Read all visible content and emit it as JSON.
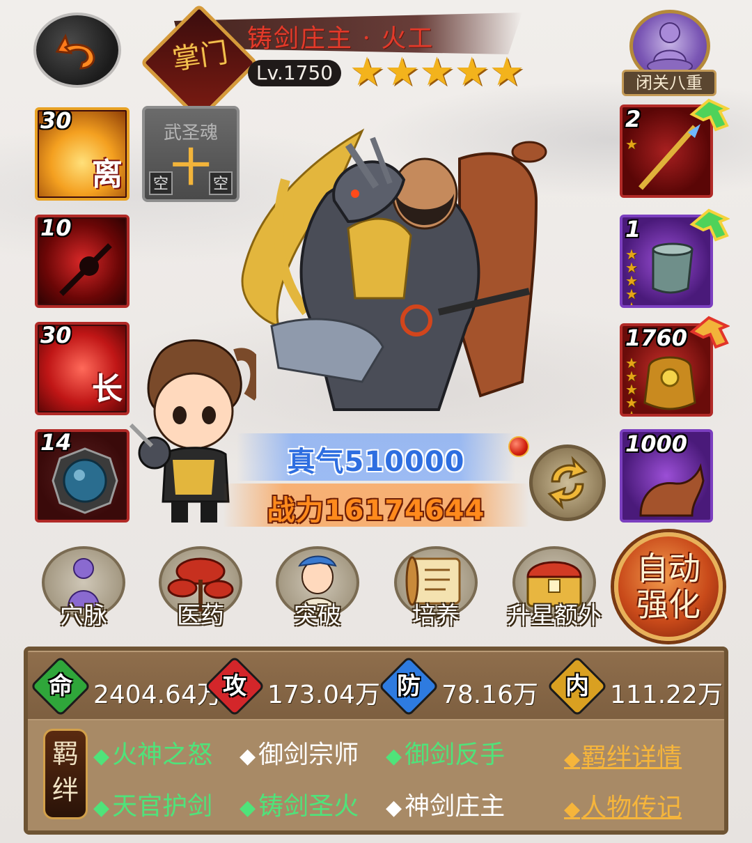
{
  "header": {
    "hero_name": "铸剑庄主 · 火工",
    "sect_label": "掌门",
    "level": "Lv.1750",
    "star_count": 5,
    "star_glyph": "★"
  },
  "meditation": {
    "label": "闭关八重"
  },
  "skills": [
    {
      "num": "30",
      "char": "离"
    },
    {
      "num": "10",
      "char": ""
    },
    {
      "num": "30",
      "char": "长"
    },
    {
      "num": "14",
      "char": ""
    }
  ],
  "soul": {
    "title": "武圣魂",
    "cross": "十",
    "empty_left": "空",
    "empty_right": "空"
  },
  "equipment": [
    {
      "num": "2",
      "stars": 1
    },
    {
      "num": "1",
      "stars": 5
    },
    {
      "num": "1760",
      "stars": 5
    },
    {
      "num": "1000",
      "stars": 0
    }
  ],
  "qi": "真气510000",
  "power": "战力16174644",
  "actions": [
    {
      "label": "穴脉"
    },
    {
      "label": "医药"
    },
    {
      "label": "突破"
    },
    {
      "label": "培养"
    },
    {
      "label": "升星额外"
    }
  ],
  "auto_enhance": {
    "line1": "自动",
    "line2": "强化"
  },
  "attributes": [
    {
      "char": "命",
      "value": "2404.64万",
      "color": "#2fa63a"
    },
    {
      "char": "攻",
      "value": "173.04万",
      "color": "#d3262a"
    },
    {
      "char": "防",
      "value": "78.16万",
      "color": "#2e7be0"
    },
    {
      "char": "内",
      "value": "111.22万",
      "color": "#d9a021"
    }
  ],
  "bonds": {
    "tag": "羁绊",
    "diamond_glyph": "◆",
    "items": [
      {
        "label": "火神之怒",
        "active": true
      },
      {
        "label": "御剑宗师",
        "active": false
      },
      {
        "label": "御剑反手",
        "active": true
      },
      {
        "label": "天官护剑",
        "active": true
      },
      {
        "label": "铸剑圣火",
        "active": true
      },
      {
        "label": "神剑庄主",
        "active": false
      }
    ],
    "details_link": "羁绊详情",
    "bio_link": "人物传记"
  }
}
